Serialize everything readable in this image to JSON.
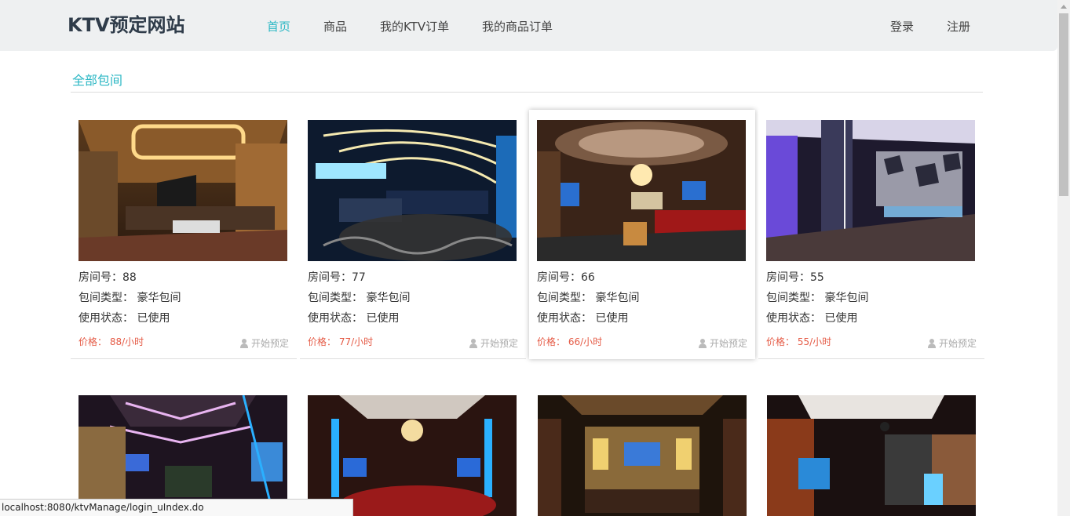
{
  "header": {
    "logo": "KTV预定网站",
    "nav": [
      "首页",
      "商品",
      "我的KTV订单",
      "我的商品订单"
    ],
    "login": "登录",
    "register": "注册"
  },
  "section": {
    "title": "全部包间"
  },
  "rooms": [
    {
      "room": "房间号：88",
      "type": "包间类型： 豪华包间",
      "status": "使用状态： 已使用",
      "price": "价格： 88/小时",
      "book": "开始预定"
    },
    {
      "room": "房间号：77",
      "type": "包间类型： 豪华包间",
      "status": "使用状态： 已使用",
      "price": "价格： 77/小时",
      "book": "开始预定"
    },
    {
      "room": "房间号：66",
      "type": "包间类型： 豪华包间",
      "status": "使用状态： 已使用",
      "price": "价格： 66/小时",
      "book": "开始预定"
    },
    {
      "room": "房间号：55",
      "type": "包间类型： 豪华包间",
      "status": "使用状态： 已使用",
      "price": "价格： 55/小时",
      "book": "开始预定"
    }
  ],
  "statusbar": {
    "url": "localhost:8080/ktvManage/login_uIndex.do"
  },
  "colors": {
    "accent": "#2bb7c4",
    "price": "#e55b46",
    "header_bg": "#eef0f1"
  }
}
